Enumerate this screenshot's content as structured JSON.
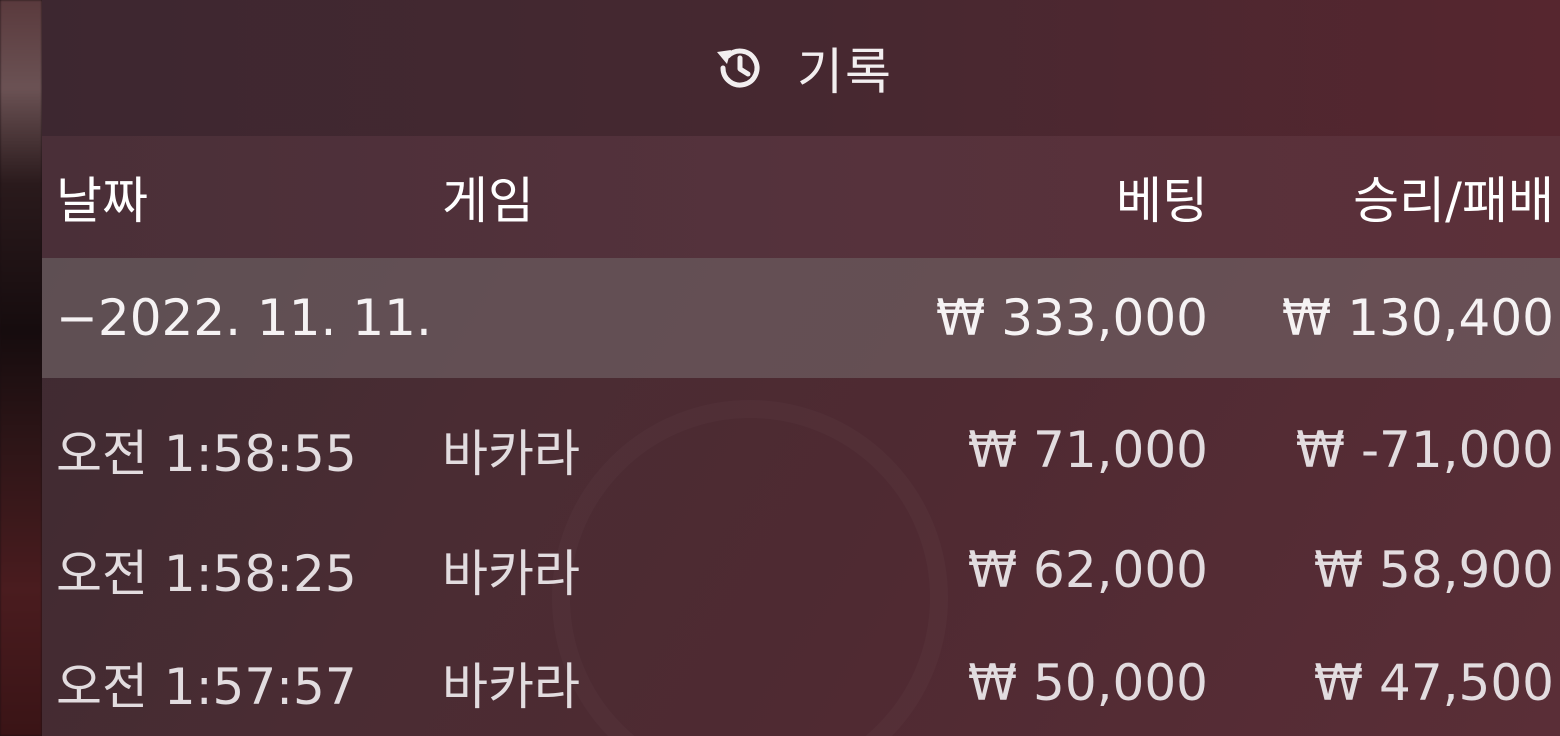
{
  "header": {
    "title": "기록",
    "icon": "history-icon"
  },
  "columns": {
    "date": "날짜",
    "game": "게임",
    "bet": "베팅",
    "result": "승리/패배"
  },
  "summary": {
    "date": "−2022. 11. 11.",
    "bet": "₩ 333,000",
    "result": "₩ 130,400"
  },
  "rows": [
    {
      "time": "오전 1:58:55",
      "game": "바카라",
      "bet": "₩ 71,000",
      "result": "₩ -71,000"
    },
    {
      "time": "오전 1:58:25",
      "game": "바카라",
      "bet": "₩ 62,000",
      "result": "₩ 58,900"
    },
    {
      "time": "오전 1:57:57",
      "game": "바카라",
      "bet": "₩ 50,000",
      "result": "₩ 47,500"
    }
  ]
}
